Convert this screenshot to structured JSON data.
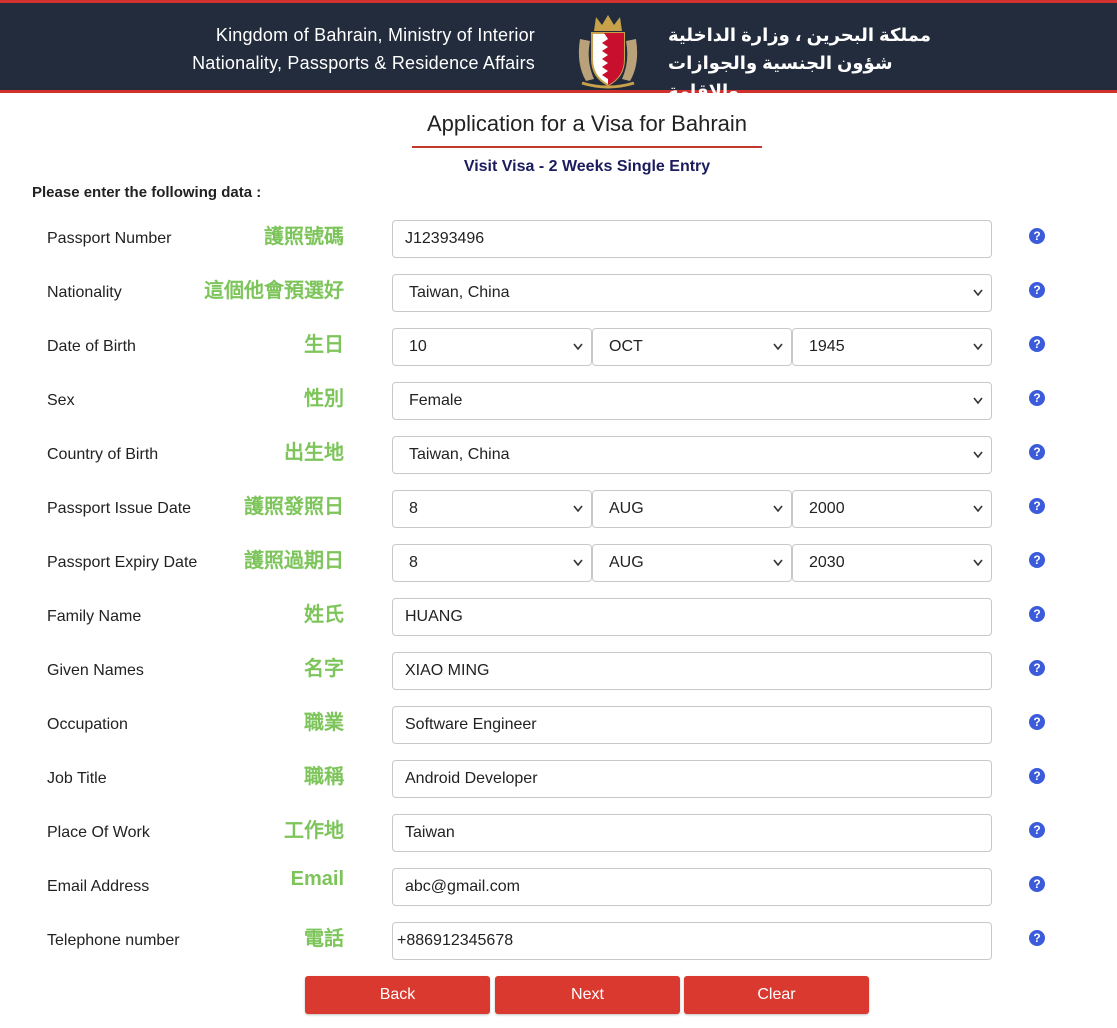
{
  "header": {
    "line1_en": "Kingdom of Bahrain, Ministry of Interior",
    "line2_en": "Nationality, Passports & Residence Affairs",
    "line1_ar": "مملكة البحرين ، وزارة الداخلية",
    "line2_ar": "شؤون الجنسية والجوازات والإقامة"
  },
  "title": "Application for a Visa for Bahrain",
  "subtitle": "Visit Visa - 2 Weeks Single Entry",
  "instruction": "Please enter the following data :",
  "fields": [
    {
      "label": "Passport Number",
      "note": "護照號碼",
      "value": "J12393496"
    },
    {
      "label": "Nationality",
      "note": "這個他會預選好",
      "value": "Taiwan, China"
    },
    {
      "label": "Date of Birth",
      "note": "生日",
      "day": "10",
      "month": "OCT",
      "year": "1945"
    },
    {
      "label": "Sex",
      "note": "性別",
      "value": "Female"
    },
    {
      "label": "Country of Birth",
      "note": "出生地",
      "value": "Taiwan, China"
    },
    {
      "label": "Passport Issue Date",
      "note": "護照發照日",
      "day": "8",
      "month": "AUG",
      "year": "2000"
    },
    {
      "label": "Passport Expiry Date",
      "note": "護照過期日",
      "day": "8",
      "month": "AUG",
      "year": "2030"
    },
    {
      "label": "Family Name",
      "note": "姓氏",
      "value": "HUANG"
    },
    {
      "label": "Given Names",
      "note": "名字",
      "value": "XIAO MING"
    },
    {
      "label": "Occupation",
      "note": "職業",
      "value": "Software Engineer"
    },
    {
      "label": "Job Title",
      "note": "職稱",
      "value": "Android Developer"
    },
    {
      "label": "Place Of Work",
      "note": "工作地",
      "value": "Taiwan"
    },
    {
      "label": "Email Address",
      "note": "Email",
      "value": "abc@gmail.com"
    },
    {
      "label": "Telephone number",
      "note": "電話",
      "value": "+886912345678"
    }
  ],
  "help_glyph": "?",
  "buttons": {
    "back": "Back",
    "next": "Next",
    "clear": "Clear"
  },
  "colors": {
    "header_bg": "#222c3c",
    "accent_red": "#d9392e",
    "note_green": "#7dc55b",
    "help_blue": "#3b5bdb"
  }
}
